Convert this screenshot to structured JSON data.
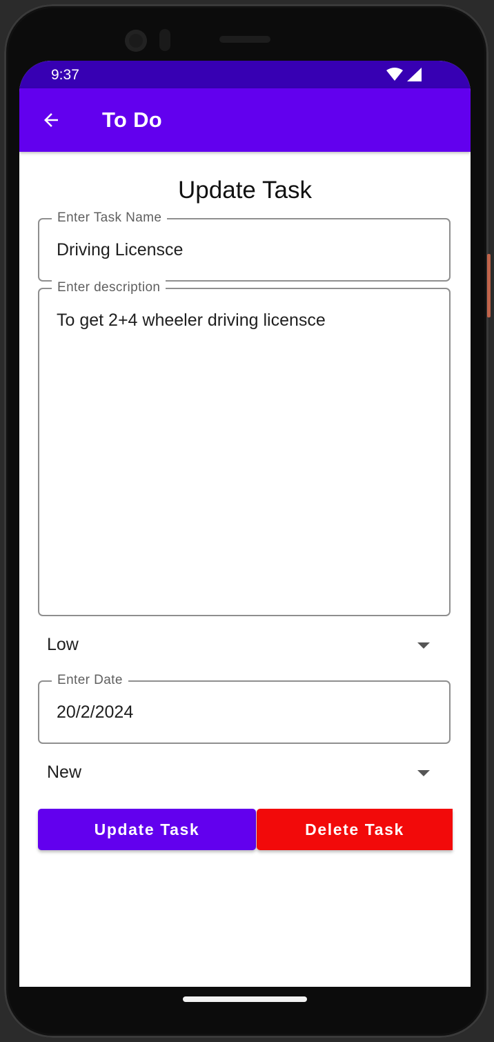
{
  "status_bar": {
    "time": "9:37"
  },
  "app_bar": {
    "title": "To Do"
  },
  "form": {
    "page_title": "Update Task",
    "task_name": {
      "label": "Enter Task Name",
      "value": "Driving Licensce"
    },
    "description": {
      "label": "Enter description",
      "value": "To get 2+4 wheeler driving licensce"
    },
    "priority": {
      "selected": "Low"
    },
    "date": {
      "label": "Enter Date",
      "value": "20/2/2024"
    },
    "status": {
      "selected": "New"
    }
  },
  "buttons": {
    "update": "Update Task",
    "delete": "Delete Task"
  },
  "colors": {
    "status_bar": "#3700b3",
    "app_bar": "#6200ee",
    "update_button": "#6200ee",
    "delete_button": "#f20a0a"
  }
}
